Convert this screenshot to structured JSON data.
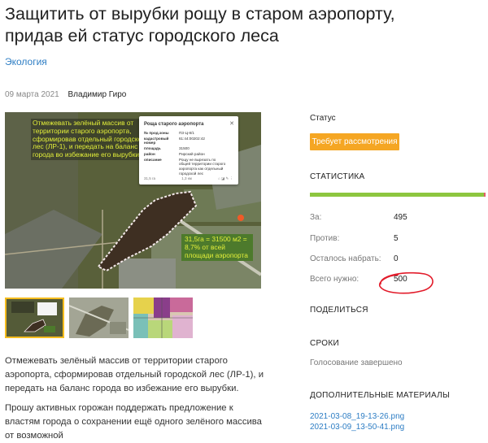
{
  "article": {
    "title_line1": "Защитить от вырубки рощу в старом аэропорту,",
    "title_line2": "придав ей статус городского леса",
    "category": "Экология",
    "date": "09 марта 2021",
    "author": "Владимир Гиро",
    "overlay_text": "Отмежевать зелёный массив от территории старого аэропорта, сформировав отдельный городской лес (ЛР-1), и передать на баланс города во избежание его вырубки.",
    "area_text": "31,5га = 31500 м2 = 8,7% от всей площади аэропорта",
    "popup": {
      "title": "Роща старого аэропорта",
      "rows": [
        {
          "k": "№ прод.зоны",
          "v": "ПЗ-Ц-8/1"
        },
        {
          "k": "кадастровый номер",
          "v": "61:44:00202:42"
        },
        {
          "k": "площадь",
          "v": "31500"
        },
        {
          "k": "район",
          "v": "Рирский район"
        },
        {
          "k": "описание",
          "v": "Рощу не вырезать по общей территории старого аэропорта как отдельный городской лес"
        }
      ],
      "footer_left": "31,5 га",
      "footer_mid": "1,3 км"
    },
    "description": "Отмежевать зелёный массив от территории старого аэропорта, сформировав отдельный городской лес (ЛР-1), и передать на баланс города во избежание его вырубки.",
    "description2": "Прошу активных горожан поддержать предложение к властям города о сохранении ещё одного зелёного массива от возможной"
  },
  "sidebar": {
    "status_label": "Статус",
    "status_badge": "Требует рассмотрения",
    "stats_title": "СТАТИСТИКА",
    "progress_fraction": 0.99,
    "stats": [
      {
        "label": "За:",
        "value": "495"
      },
      {
        "label": "Против:",
        "value": "5"
      },
      {
        "label": "Осталось набрать:",
        "value": "0"
      },
      {
        "label": "Всего нужно:",
        "value": "500"
      }
    ],
    "share_title": "ПОДЕЛИТЬСЯ",
    "terms_title": "СРОКИ",
    "terms_value": "Голосование завершено",
    "materials_title": "ДОПОЛНИТЕЛЬНЫЕ МАТЕРИАЛЫ",
    "files": [
      "2021-03-08_19-13-26.png",
      "2021-03-09_13-50-41.png"
    ]
  },
  "colors": {
    "accent": "#2d7dc4",
    "status": "#f5a623",
    "progress": "#8dc63f",
    "annotation": "#e21b2a"
  }
}
